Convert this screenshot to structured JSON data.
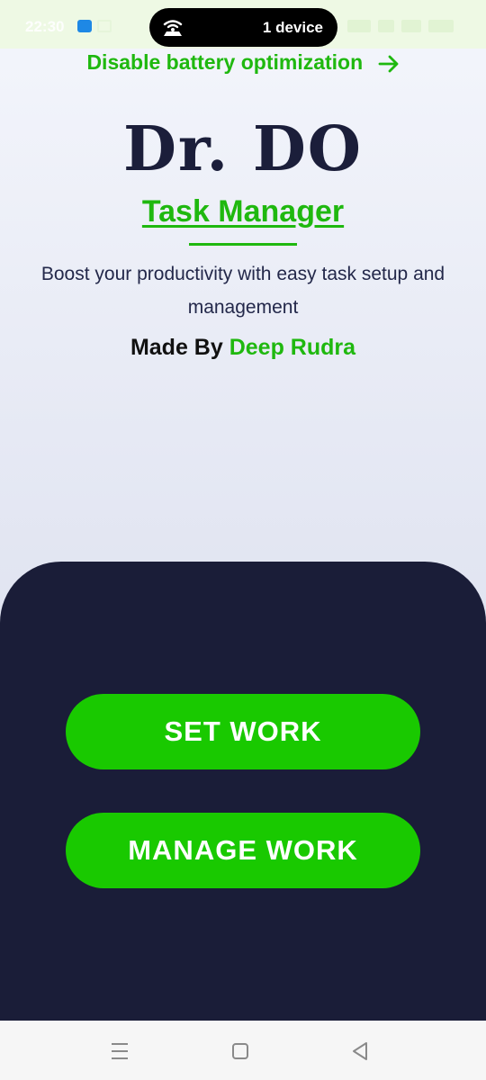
{
  "status_bar": {
    "time": "22:30",
    "hotspot_label": "1 device"
  },
  "battery_link": {
    "label": "Disable battery optimization",
    "arrow_icon": "arrow-right-icon"
  },
  "header": {
    "title": "Dr. DO",
    "subtitle": "Task Manager",
    "description": "Boost your productivity with easy task setup and management",
    "credit_prefix": "Made By",
    "credit_name": "Deep Rudra"
  },
  "actions": {
    "set_work_label": "SET WORK",
    "manage_work_label": "MANAGE WORK"
  },
  "colors": {
    "accent_green": "#19c900",
    "text_green": "#1fb80f",
    "panel_navy": "#1a1d38",
    "title_navy": "#1b1e3a"
  },
  "nav_bar": {
    "icons": [
      "menu-icon",
      "home-icon",
      "back-icon"
    ]
  }
}
